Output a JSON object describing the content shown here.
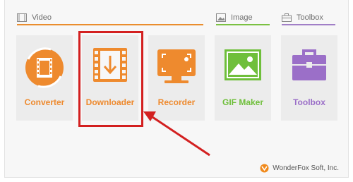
{
  "sections": {
    "video": {
      "title": "Video",
      "icon": "film-frame-icon",
      "color": "#ea8d2e"
    },
    "image": {
      "title": "Image",
      "icon": "picture-icon",
      "color": "#7bc142"
    },
    "toolbox": {
      "title": "Toolbox",
      "icon": "toolbox-icon",
      "color": "#a17fc7"
    }
  },
  "tools": [
    {
      "label": "Converter",
      "icon": "film-reel-convert-icon",
      "color": "#ee8a2e"
    },
    {
      "label": "Downloader",
      "icon": "download-film-icon",
      "color": "#ee8a2e"
    },
    {
      "label": "Recorder",
      "icon": "screen-recorder-icon",
      "color": "#ee8a2e"
    },
    {
      "label": "GIF Maker",
      "icon": "gif-image-icon",
      "color": "#6fbf3b"
    },
    {
      "label": "Toolbox",
      "icon": "toolbox-icon",
      "color": "#9b6fc8"
    }
  ],
  "annotation": {
    "highlight_color": "#d32020",
    "highlighted_tool": "Downloader"
  },
  "footer": {
    "brand": "WonderFox Soft, Inc.",
    "icon": "wonderfox-logo-icon"
  }
}
